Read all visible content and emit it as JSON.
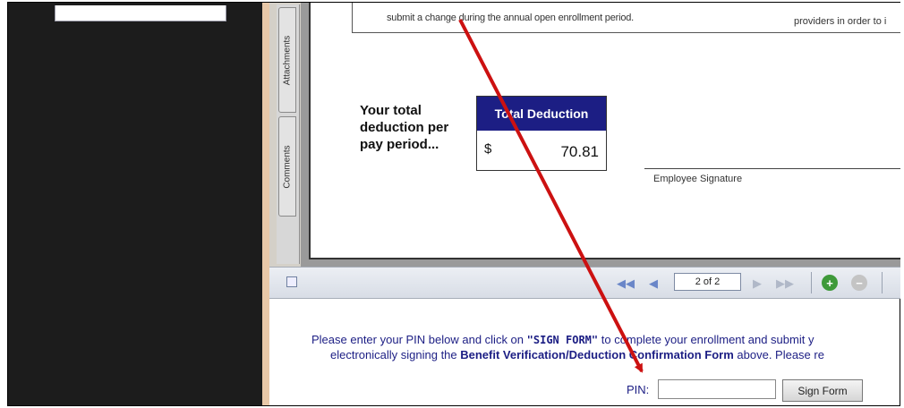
{
  "sidebar": {
    "tabs": [
      "Attachments",
      "Comments"
    ]
  },
  "document": {
    "line_text_1": "submit a change during the annual open enrollment period.",
    "line_text_2": "providers in order to i",
    "total_label": "Your total deduction per pay period...",
    "total_header": "Total Deduction",
    "currency": "$",
    "total_amount": "70.81",
    "signature_label": "Employee Signature"
  },
  "toolbar": {
    "page_indicator": "2 of 2",
    "icons": [
      "first-page-icon",
      "prev-page-icon",
      "next-page-icon",
      "last-page-icon",
      "zoom-in-icon",
      "zoom-out-icon"
    ]
  },
  "instructions": {
    "l1_a": "Please enter your PIN below and click on ",
    "l1_b": "\"SIGN FORM\"",
    "l1_c": " to complete your enrollment and submit y",
    "l2_a": "electronically signing the ",
    "l2_b": "Benefit Verification/Deduction Confirmation Form",
    "l2_c": " above. Please re"
  },
  "pin_form": {
    "label": "PIN:",
    "value": "",
    "button_label": "Sign Form"
  },
  "colors": {
    "accent": "#1c1e84",
    "arrow": "#cc1111",
    "left_panel": "#1c1c1c"
  }
}
